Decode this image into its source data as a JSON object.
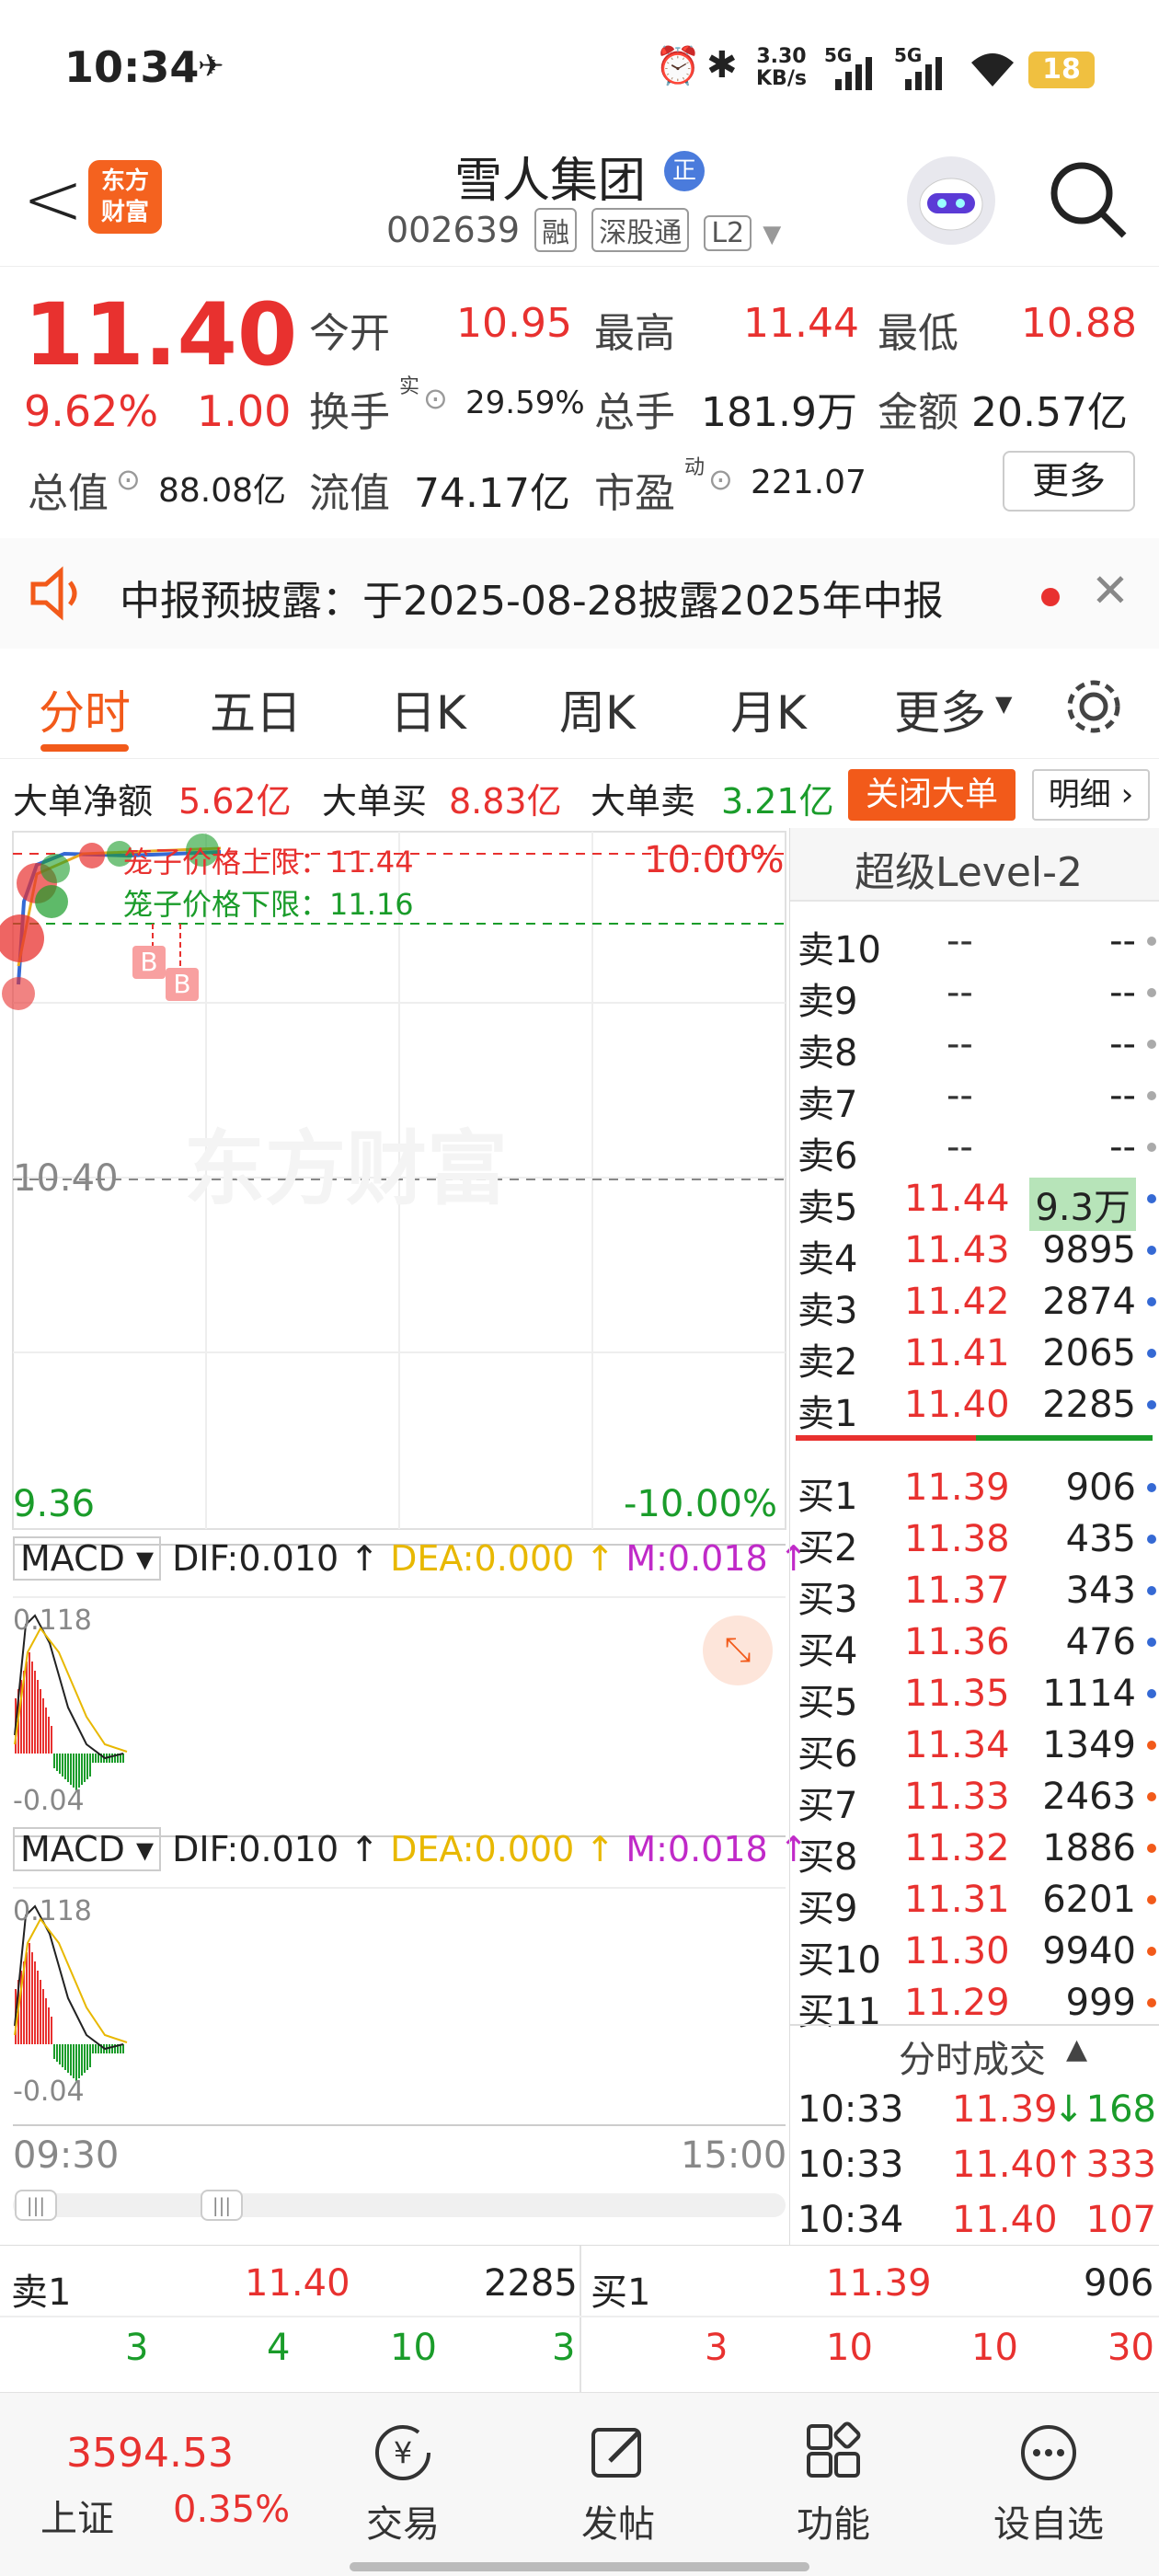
{
  "status": {
    "time": "10:34",
    "net_speed_top": "3.30",
    "net_speed_bottom": "KB/s",
    "sig1": "5G",
    "sig2": "5G",
    "battery": "18"
  },
  "header": {
    "back": "<",
    "logo_line1": "东方",
    "logo_line2": "财富",
    "name": "雪人集团",
    "badge": "正",
    "code": "002639",
    "tag1": "融",
    "tag2": "深股通",
    "tag3": "L2"
  },
  "quote": {
    "price": "11.40",
    "pct": "9.62%",
    "chg": "1.00",
    "open_label": "今开",
    "open": "10.95",
    "high_label": "最高",
    "high": "11.44",
    "low_label": "最低",
    "low": "10.88",
    "turnover_label": "换手",
    "turnover_sup": "实",
    "turnover": "29.59%",
    "vol_label": "总手",
    "vol": "181.9万",
    "amt_label": "金额",
    "amt": "20.57亿",
    "mktcap_label": "总值",
    "mktcap": "88.08亿",
    "float_label": "流值",
    "float": "74.17亿",
    "pe_label": "市盈",
    "pe_sup": "动",
    "pe": "221.07",
    "more": "更多"
  },
  "notice": {
    "text": "中报预披露：于2025-08-28披露2025年中报"
  },
  "tabs": [
    "分时",
    "五日",
    "日K",
    "周K",
    "月K",
    "更多"
  ],
  "bigorder": {
    "net_label": "大单净额",
    "net": "5.62亿",
    "buy_label": "大单买",
    "buy": "8.83亿",
    "sell_label": "大单卖",
    "sell": "3.21亿",
    "close_btn": "关闭大单",
    "detail_btn": "明细"
  },
  "chart": {
    "upper_limit": "笼子价格上限：11.44",
    "lower_limit": "笼子价格下限：11.16",
    "pct_top": "10.00%",
    "mid": "10.40",
    "price_bottom": "9.36",
    "pct_bottom": "-10.00%",
    "watermark": "东方财富",
    "b1": "B",
    "b2": "B",
    "macd": {
      "label": "MACD",
      "dif": "DIF:0.010",
      "dea": "DEA:0.000",
      "m": "M:0.018",
      "top": "0.118",
      "bottom": "-0.04"
    },
    "time_start": "09:30",
    "time_end": "15:00"
  },
  "book": {
    "title": "超级Level-2",
    "asks": [
      {
        "l": "卖10",
        "p": "--",
        "v": "--"
      },
      {
        "l": "卖9",
        "p": "--",
        "v": "--"
      },
      {
        "l": "卖8",
        "p": "--",
        "v": "--"
      },
      {
        "l": "卖7",
        "p": "--",
        "v": "--"
      },
      {
        "l": "卖6",
        "p": "--",
        "v": "--"
      },
      {
        "l": "卖5",
        "p": "11.44",
        "v": "9.3万"
      },
      {
        "l": "卖4",
        "p": "11.43",
        "v": "9895"
      },
      {
        "l": "卖3",
        "p": "11.42",
        "v": "2874"
      },
      {
        "l": "卖2",
        "p": "11.41",
        "v": "2065"
      },
      {
        "l": "卖1",
        "p": "11.40",
        "v": "2285"
      }
    ],
    "bids": [
      {
        "l": "买1",
        "p": "11.39",
        "v": "906"
      },
      {
        "l": "买2",
        "p": "11.38",
        "v": "435"
      },
      {
        "l": "买3",
        "p": "11.37",
        "v": "343"
      },
      {
        "l": "买4",
        "p": "11.36",
        "v": "476"
      },
      {
        "l": "买5",
        "p": "11.35",
        "v": "1114"
      },
      {
        "l": "买6",
        "p": "11.34",
        "v": "1349"
      },
      {
        "l": "买7",
        "p": "11.33",
        "v": "2463"
      },
      {
        "l": "买8",
        "p": "11.32",
        "v": "1886"
      },
      {
        "l": "买9",
        "p": "11.31",
        "v": "6201"
      },
      {
        "l": "买10",
        "p": "11.30",
        "v": "9940"
      },
      {
        "l": "买11",
        "p": "11.29",
        "v": "999"
      }
    ],
    "trades_title": "分时成交",
    "trades": [
      {
        "t": "10:33",
        "p": "11.39",
        "arrow": "↓",
        "v": "168"
      },
      {
        "t": "10:33",
        "p": "11.40",
        "arrow": "↑",
        "v": "333"
      },
      {
        "t": "10:34",
        "p": "11.40",
        "arrow": "",
        "v": "107"
      }
    ]
  },
  "summary": {
    "sell_label": "卖1",
    "sell_price": "11.40",
    "sell_vol": "2285",
    "buy_label": "买1",
    "buy_price": "11.39",
    "buy_vol": "906",
    "sell_row": [
      "3",
      "4",
      "10",
      "3"
    ],
    "buy_row": [
      "3",
      "10",
      "10",
      "30"
    ]
  },
  "nav": {
    "index_value": "3594.53",
    "index_name": "上证",
    "index_pct": "0.35%",
    "trade": "交易",
    "post": "发帖",
    "func": "功能",
    "watch": "设自选"
  }
}
